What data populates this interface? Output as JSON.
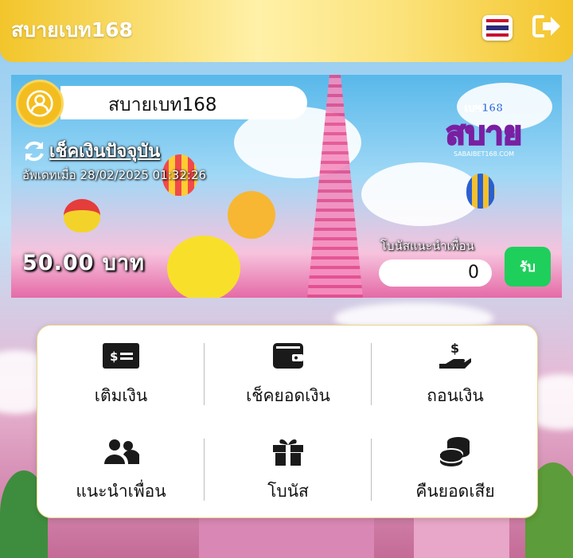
{
  "header": {
    "brand": "สบายเบท168",
    "flag_icon": "thailand-flag-icon",
    "logout_icon": "logout-icon"
  },
  "banner": {
    "username": "สบายเบท168",
    "check_balance_label": "เช็คเงินปัจจุบัน",
    "updated_text": "อัพเดทเมื่อ 28/02/2025 01:32:26",
    "balance": "50.00 บาท",
    "logo_text": "สบาย",
    "logo_top": "เบท168",
    "logo_sub": "SABAIBET168.COM",
    "bonus_label": "โบนัสแนะนำเพื่อน",
    "bonus_value": "0",
    "claim_label": "รับ"
  },
  "menu": {
    "items": [
      {
        "label": "เติมเงิน",
        "icon": "money-bill-icon"
      },
      {
        "label": "เช็คยอดเงิน",
        "icon": "wallet-icon"
      },
      {
        "label": "ถอนเงิน",
        "icon": "hand-dollar-icon"
      },
      {
        "label": "แนะนำเพื่อน",
        "icon": "users-icon"
      },
      {
        "label": "โบนัส",
        "icon": "gift-icon"
      },
      {
        "label": "คืนยอดเสีย",
        "icon": "coins-icon"
      }
    ]
  },
  "colors": {
    "header_gold": "#f2c52a",
    "claim_green": "#1fcf5c",
    "avatar_gold": "#f4bd1f"
  }
}
